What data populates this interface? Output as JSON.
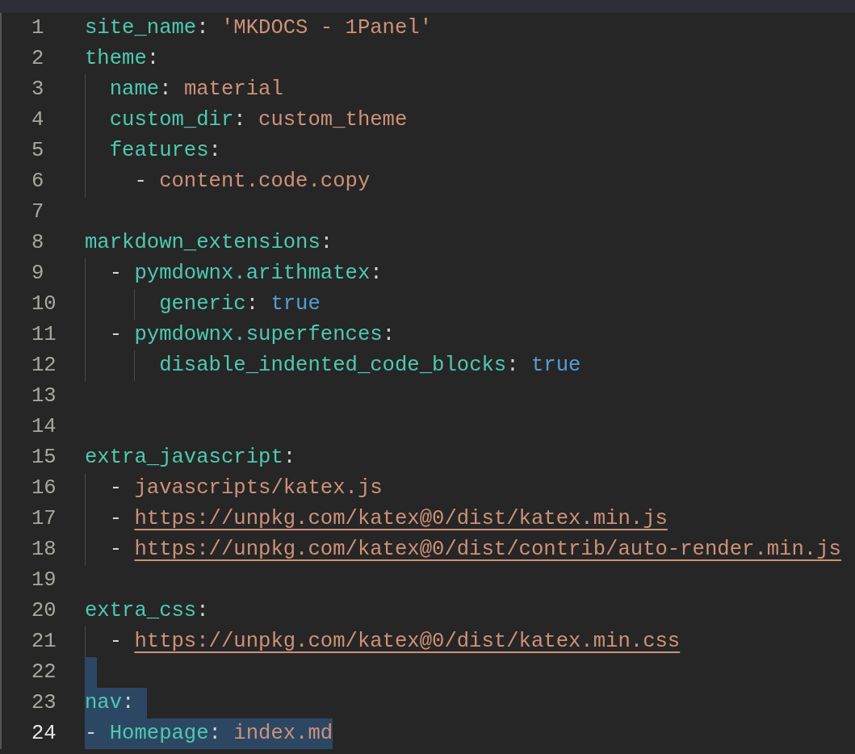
{
  "editor": {
    "lines": [
      {
        "number": "1",
        "selected": false,
        "current": false,
        "tokens": [
          {
            "kind": "key",
            "text": "site_name"
          },
          {
            "kind": "punct",
            "text": ":"
          },
          {
            "kind": "string",
            "text": "'MKDOCS - 1Panel'"
          }
        ]
      },
      {
        "number": "2",
        "selected": false,
        "current": false,
        "tokens": [
          {
            "kind": "key",
            "text": "theme"
          },
          {
            "kind": "punct",
            "text": ":"
          }
        ],
        "children": [
          {
            "number": "3",
            "selected": false,
            "current": false,
            "tokens": [
              {
                "kind": "key",
                "text": "name"
              },
              {
                "kind": "punct",
                "text": ":"
              },
              {
                "kind": "string",
                "text": "material"
              }
            ]
          },
          {
            "number": "4",
            "selected": false,
            "current": false,
            "tokens": [
              {
                "kind": "key",
                "text": "custom_dir"
              },
              {
                "kind": "punct",
                "text": ":"
              },
              {
                "kind": "string",
                "text": "custom_theme"
              }
            ]
          },
          {
            "number": "5",
            "selected": false,
            "current": false,
            "tokens": [
              {
                "kind": "key",
                "text": "features"
              },
              {
                "kind": "punct",
                "text": ":"
              }
            ],
            "children": [
              {
                "number": "6",
                "selected": false,
                "current": false,
                "tokens": [
                  {
                    "kind": "dash",
                    "text": "-"
                  },
                  {
                    "kind": "string",
                    "text": "content.code.copy"
                  }
                ]
              }
            ]
          }
        ]
      },
      {
        "number": "7",
        "selected": false,
        "current": false
      },
      {
        "number": "8",
        "selected": false,
        "current": false,
        "tokens": [
          {
            "kind": "key",
            "text": "markdown_extensions"
          },
          {
            "kind": "punct",
            "text": ":"
          }
        ],
        "children": [
          {
            "number": "9",
            "selected": false,
            "current": false,
            "tokens": [
              {
                "kind": "dash",
                "text": "-"
              },
              {
                "kind": "key",
                "text": "pymdownx.arithmatex"
              },
              {
                "kind": "punct",
                "text": ":"
              }
            ],
            "children": [
              {
                "number": "10",
                "selected": false,
                "current": false,
                "tokens": [
                  {
                    "kind": "key",
                    "text": "generic"
                  },
                  {
                    "kind": "punct",
                    "text": ":"
                  },
                  {
                    "kind": "bool",
                    "text": "true"
                  }
                ]
              }
            ]
          },
          {
            "number": "11",
            "selected": false,
            "current": false,
            "tokens": [
              {
                "kind": "dash",
                "text": "-"
              },
              {
                "kind": "key",
                "text": "pymdownx.superfences"
              },
              {
                "kind": "punct",
                "text": ":"
              }
            ],
            "children": [
              {
                "number": "12",
                "selected": false,
                "current": false,
                "tokens": [
                  {
                    "kind": "key",
                    "text": "disable_indented_code_blocks"
                  },
                  {
                    "kind": "punct",
                    "text": ":"
                  },
                  {
                    "kind": "bool",
                    "text": "true"
                  }
                ]
              }
            ]
          }
        ]
      },
      {
        "number": "13",
        "selected": false,
        "current": false
      },
      {
        "number": "14",
        "selected": false,
        "current": false
      },
      {
        "number": "15",
        "selected": false,
        "current": false,
        "tokens": [
          {
            "kind": "key",
            "text": "extra_javascript"
          },
          {
            "kind": "punct",
            "text": ":"
          }
        ],
        "children": [
          {
            "number": "16",
            "selected": false,
            "current": false,
            "tokens": [
              {
                "kind": "dash",
                "text": "-"
              },
              {
                "kind": "string",
                "text": "javascripts/katex.js"
              }
            ]
          },
          {
            "number": "17",
            "selected": false,
            "current": false,
            "tokens": [
              {
                "kind": "dash",
                "text": "-"
              },
              {
                "kind": "link",
                "text": "https://unpkg.com/katex@0/dist/katex.min.js"
              }
            ]
          },
          {
            "number": "18",
            "selected": false,
            "current": false,
            "tokens": [
              {
                "kind": "dash",
                "text": "-"
              },
              {
                "kind": "link",
                "text": "https://unpkg.com/katex@0/dist/contrib/auto-render.min.js"
              }
            ]
          }
        ]
      },
      {
        "number": "19",
        "selected": false,
        "current": false
      },
      {
        "number": "20",
        "selected": false,
        "current": false,
        "tokens": [
          {
            "kind": "key",
            "text": "extra_css"
          },
          {
            "kind": "punct",
            "text": ":"
          }
        ],
        "children": [
          {
            "number": "21",
            "selected": false,
            "current": false,
            "tokens": [
              {
                "kind": "dash",
                "text": "-"
              },
              {
                "kind": "link",
                "text": "https://unpkg.com/katex@0/dist/katex.min.css"
              }
            ]
          }
        ]
      },
      {
        "number": "22",
        "selected": true,
        "current": false
      },
      {
        "number": "23",
        "selected": true,
        "current": false,
        "tokens": [
          {
            "kind": "key",
            "text": "nav"
          },
          {
            "kind": "punct",
            "text": ":"
          }
        ]
      },
      {
        "number": "24",
        "selected": true,
        "current": true,
        "tokens": [
          {
            "kind": "dash",
            "text": "-"
          },
          {
            "kind": "key",
            "text": "Homepage"
          },
          {
            "kind": "punct",
            "text": ":"
          },
          {
            "kind": "string",
            "text": "index.md"
          }
        ]
      }
    ]
  }
}
